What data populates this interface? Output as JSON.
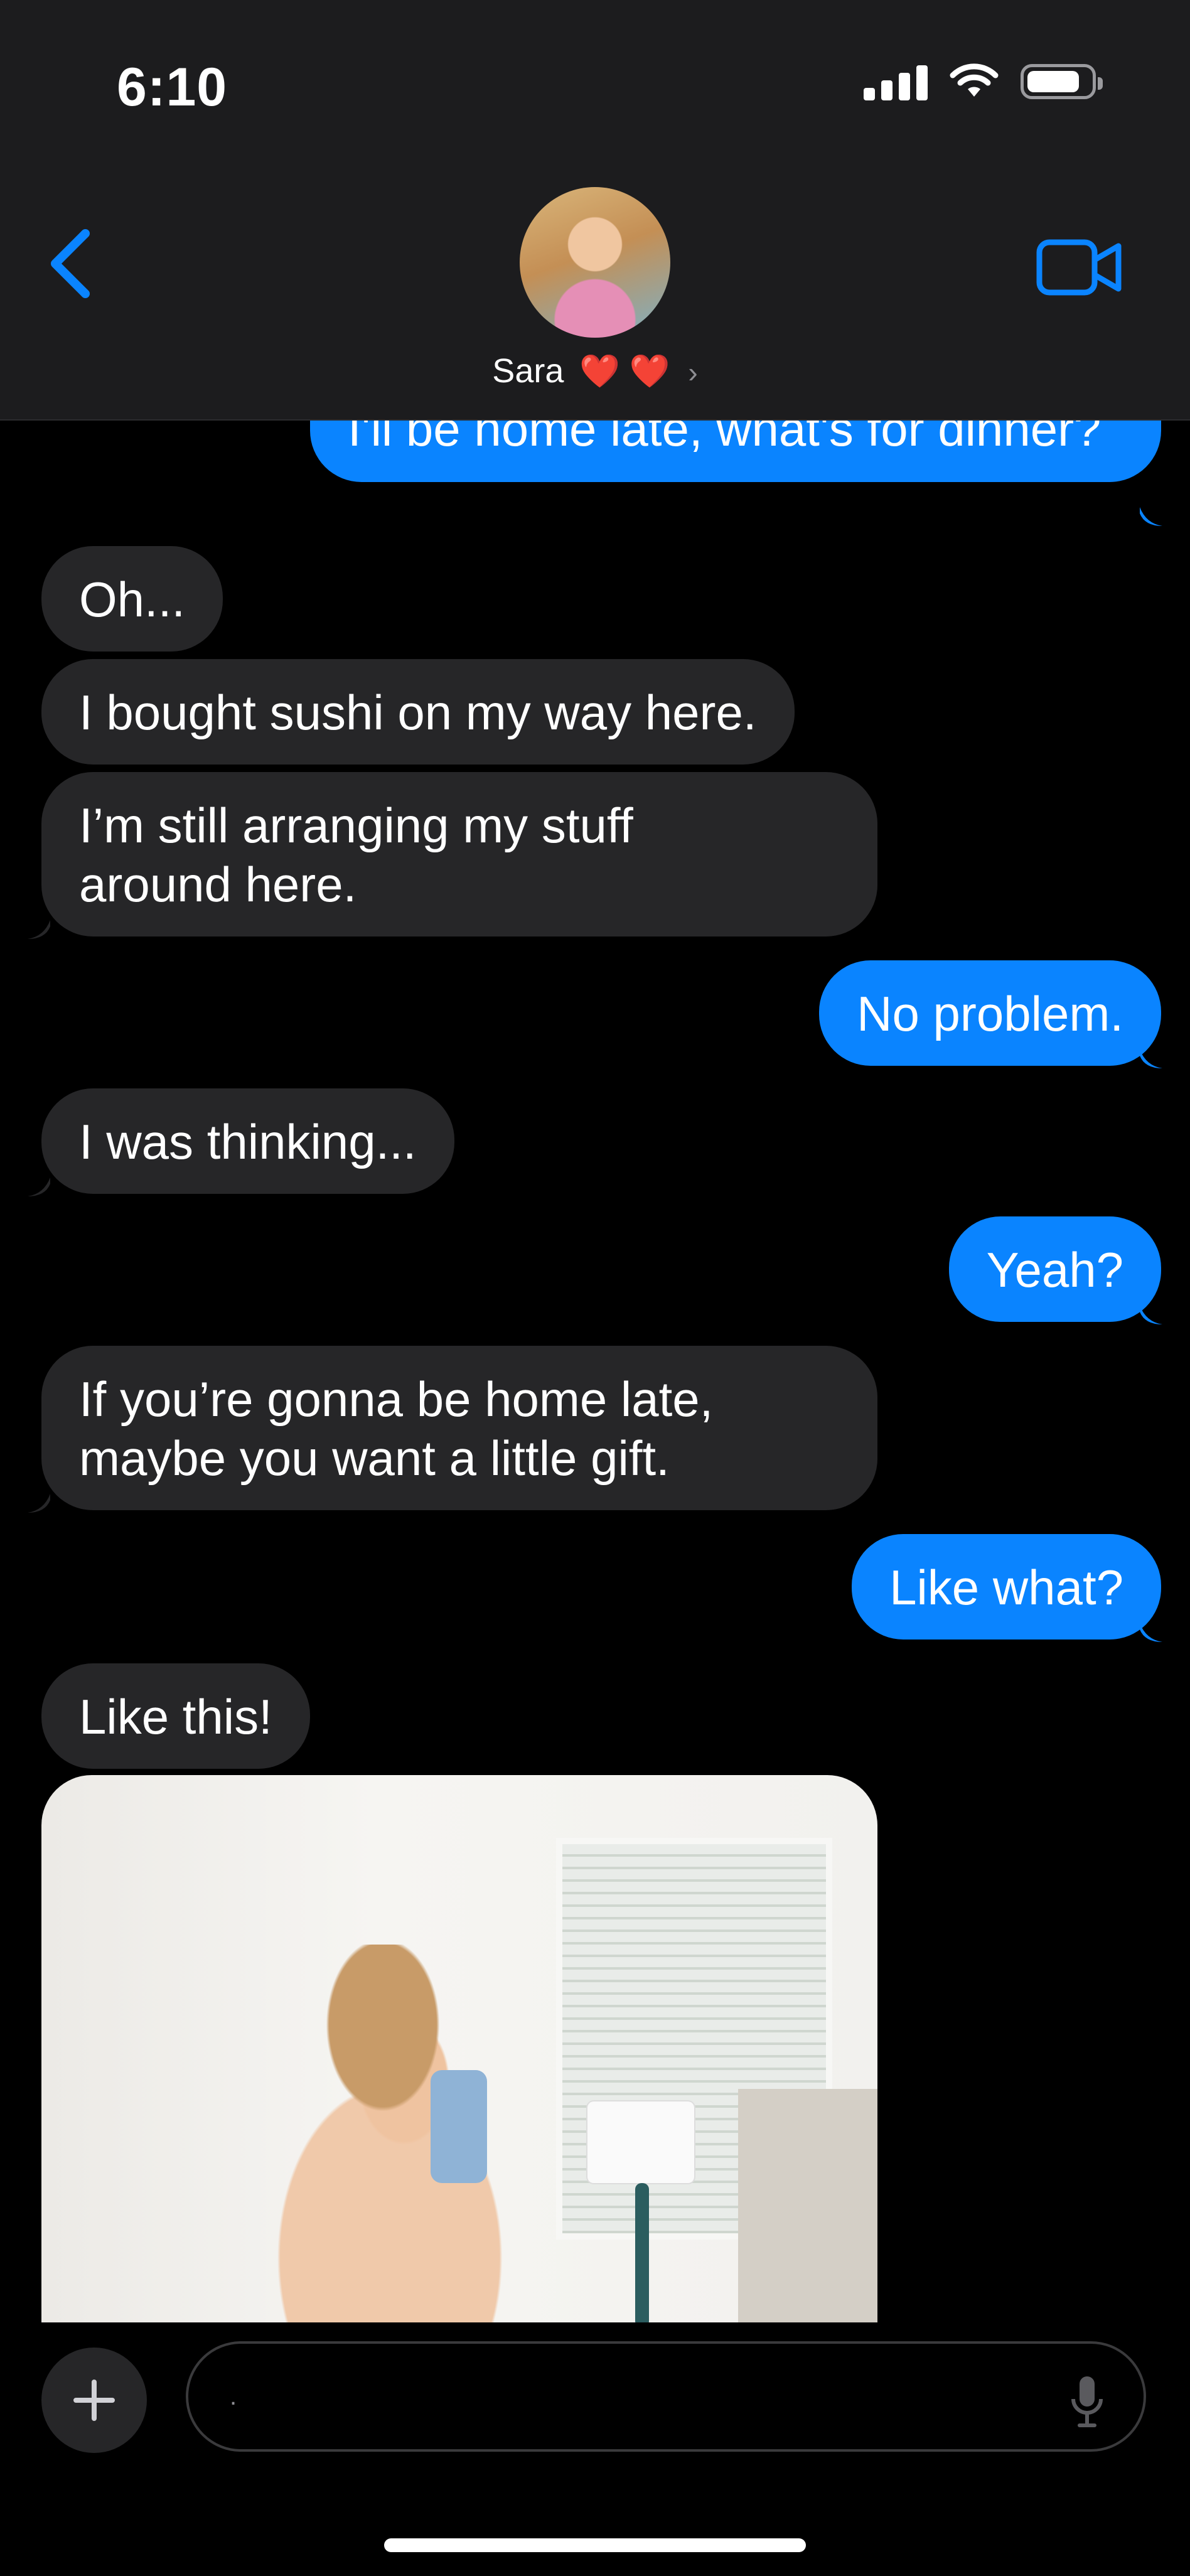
{
  "status_bar": {
    "time": "6:10"
  },
  "header": {
    "contact_name": "Sara",
    "contact_hearts": "❤️ ❤️",
    "chevron": "›",
    "back_icon": "chevron-left-icon",
    "video_icon": "video-camera-icon"
  },
  "messages": [
    {
      "from": "me",
      "text": "I'll be home late, what's for dinner?"
    },
    {
      "from": "them",
      "text": "Oh..."
    },
    {
      "from": "them",
      "text": "I bought sushi on my way here."
    },
    {
      "from": "them",
      "text": "I’m still arranging my stuff around here."
    },
    {
      "from": "me",
      "text": "No problem."
    },
    {
      "from": "them",
      "text": "I was thinking..."
    },
    {
      "from": "me",
      "text": "Yeah?"
    },
    {
      "from": "them",
      "text": "If you’re gonna be home late, maybe you want a little gift."
    },
    {
      "from": "me",
      "text": "Like what?"
    },
    {
      "from": "them",
      "text": "Like this!"
    }
  ],
  "composer": {
    "value": ".",
    "plus_icon": "plus-icon",
    "mic_icon": "microphone-icon"
  },
  "colors": {
    "outgoing": "#0a84ff",
    "incoming": "#262628",
    "accent": "#0a84ff"
  }
}
